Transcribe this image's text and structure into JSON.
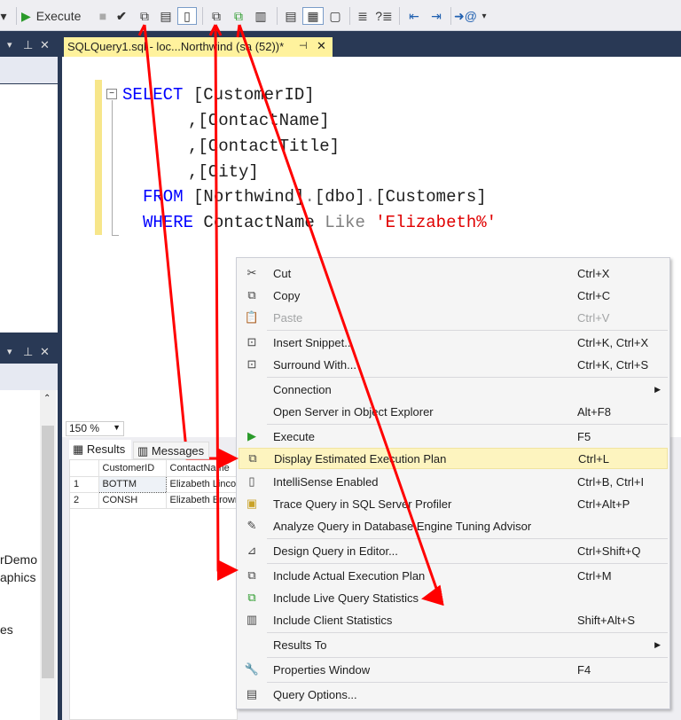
{
  "toolbar": {
    "execute_label": "Execute"
  },
  "tab": {
    "title": "SQLQuery1.sql - loc...Northwind (sa (52))*"
  },
  "code": {
    "l1a": "SELECT",
    "l1b": " [CustomerID]",
    "l2": ",[ContactName]",
    "l3": ",[ContactTitle]",
    "l4": ",[City]",
    "l5a": "FROM",
    "l5b": " [Northwind]",
    "l5c": ".",
    "l5d": "[dbo]",
    "l5e": ".",
    "l5f": "[Customers]",
    "l6a": "WHERE",
    "l6b": " ContactName ",
    "l6c": "Like",
    "l6d": " ",
    "l6e": "'Elizabeth%'"
  },
  "zoom": "150 %",
  "results": {
    "tabs": [
      "Results",
      "Messages"
    ],
    "columns": [
      "CustomerID",
      "ContactName"
    ],
    "rows": [
      [
        "1",
        "BOTTM",
        "Elizabeth Lincoln"
      ],
      [
        "2",
        "CONSH",
        "Elizabeth Brown"
      ]
    ]
  },
  "left_panel": {
    "items": [
      "rDemo",
      "aphics",
      "es"
    ]
  },
  "menu": {
    "items": [
      {
        "label": "Cut",
        "shortcut": "Ctrl+X"
      },
      {
        "label": "Copy",
        "shortcut": "Ctrl+C"
      },
      {
        "label": "Paste",
        "shortcut": "Ctrl+V"
      },
      {
        "label": "Insert Snippet...",
        "shortcut": "Ctrl+K, Ctrl+X"
      },
      {
        "label": "Surround With...",
        "shortcut": "Ctrl+K, Ctrl+S"
      },
      {
        "label": "Connection",
        "shortcut": ""
      },
      {
        "label": "Open Server in Object Explorer",
        "shortcut": "Alt+F8"
      },
      {
        "label": "Execute",
        "shortcut": "F5"
      },
      {
        "label": "Display Estimated Execution Plan",
        "shortcut": "Ctrl+L"
      },
      {
        "label": "IntelliSense Enabled",
        "shortcut": "Ctrl+B, Ctrl+I"
      },
      {
        "label": "Trace Query in SQL Server Profiler",
        "shortcut": "Ctrl+Alt+P"
      },
      {
        "label": "Analyze Query in Database Engine Tuning Advisor",
        "shortcut": ""
      },
      {
        "label": "Design Query in Editor...",
        "shortcut": "Ctrl+Shift+Q"
      },
      {
        "label": "Include Actual Execution Plan",
        "shortcut": "Ctrl+M"
      },
      {
        "label": "Include Live Query Statistics",
        "shortcut": ""
      },
      {
        "label": "Include Client Statistics",
        "shortcut": "Shift+Alt+S"
      },
      {
        "label": "Results To",
        "shortcut": ""
      },
      {
        "label": "Properties Window",
        "shortcut": "F4"
      },
      {
        "label": "Query Options...",
        "shortcut": ""
      }
    ]
  },
  "colors": {
    "accent": "#ff0000",
    "tab": "#fff29d",
    "highlight": "#fdf4bf"
  }
}
